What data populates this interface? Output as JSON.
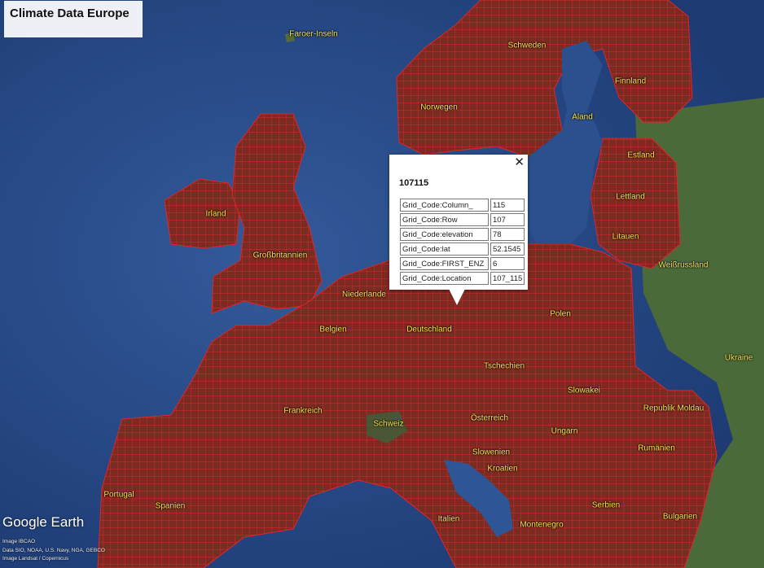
{
  "app": {
    "title": "Climate Data Europe"
  },
  "popup": {
    "title": "107115",
    "close_label": "✕",
    "rows": [
      {
        "key": "Grid_Code:Column_",
        "value": "115"
      },
      {
        "key": "Grid_Code:Row",
        "value": "107"
      },
      {
        "key": "Grid_Code:elevation",
        "value": "78"
      },
      {
        "key": "Grid_Code:lat",
        "value": "52.1545"
      },
      {
        "key": "Grid_Code:FIRST_ENZ",
        "value": "6"
      },
      {
        "key": "Grid_Code:Location",
        "value": "107_115"
      }
    ]
  },
  "labels": [
    "Faroer-Inseln",
    "Schweden",
    "Finnland",
    "Norwegen",
    "Aland",
    "Estland",
    "Lettland",
    "Irland",
    "Litauen",
    "Großbritannien",
    "Weißrussland",
    "Niederlande",
    "Polen",
    "Belgien",
    "Deutschland",
    "Ukraine",
    "Tschechien",
    "Slowakei",
    "Frankreich",
    "Republik Moldau",
    "Österreich",
    "Schweiz",
    "Ungarn",
    "Rumänien",
    "Slowenien",
    "Kroatien",
    "Portugal",
    "Spanien",
    "Serbien",
    "Bulgarien",
    "Italien",
    "Montenegro"
  ],
  "branding": {
    "logo": "Google Earth",
    "credits": [
      "Image IBCAO",
      "Data SIO, NOAA, U.S. Navy, NGA, GEBCO",
      "Image Landsat / Copernicus"
    ]
  },
  "colors": {
    "ocean": "#2c4f8e",
    "grid_fill": "#7a2b22",
    "grid_line": "#e0262a",
    "land": "#4a6a3a",
    "label": "#f5e24a"
  }
}
